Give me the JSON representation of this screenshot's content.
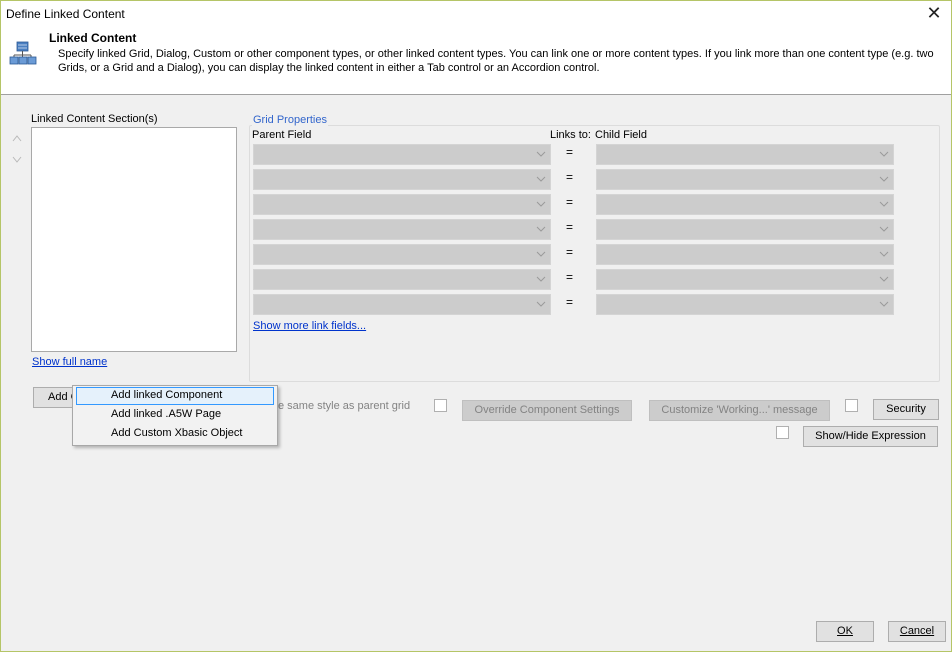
{
  "window": {
    "title": "Define Linked Content",
    "close_glyph": "✕"
  },
  "header": {
    "title": "Linked Content",
    "description": "Specify linked Grid, Dialog, Custom or other component types, or other linked content types. You can link one or more content types. If you link more than one content type (e.g. two Grids, or a Grid and a Dialog), you can display the linked content in either a Tab control or an Accordion control.",
    "icon": "linked-content-icon"
  },
  "left_panel": {
    "section_label": "Linked Content Section(s)",
    "items": [],
    "show_full_name_link": "Show full name",
    "move_up_icon": "triangle-up-icon",
    "move_down_icon": "triangle-down-icon"
  },
  "grid_properties": {
    "legend": "Grid Properties",
    "parent_field_header": "Parent Field",
    "links_to_header": "Links to:",
    "child_field_header": "Child Field",
    "rows": [
      {
        "parent": "",
        "operator": "=",
        "child": ""
      },
      {
        "parent": "",
        "operator": "=",
        "child": ""
      },
      {
        "parent": "",
        "operator": "=",
        "child": ""
      },
      {
        "parent": "",
        "operator": "=",
        "child": ""
      },
      {
        "parent": "",
        "operator": "=",
        "child": ""
      },
      {
        "parent": "",
        "operator": "=",
        "child": ""
      },
      {
        "parent": "",
        "operator": "=",
        "child": ""
      }
    ],
    "show_more_link": "Show more link fields..."
  },
  "actions": {
    "add_button_label": "Add C",
    "same_style_label": "e same style as parent grid",
    "override_button": "Override Component Settings",
    "customize_button": "Customize 'Working...' message",
    "security_button": "Security",
    "show_hide_button": "Show/Hide Expression"
  },
  "context_menu": {
    "items": [
      {
        "label": "Add linked Component",
        "highlighted": true
      },
      {
        "label": "Add linked .A5W Page",
        "highlighted": false
      },
      {
        "label": "Add Custom Xbasic Object",
        "highlighted": false
      }
    ]
  },
  "footer": {
    "ok_label": "OK",
    "cancel_label": "Cancel"
  },
  "colors": {
    "accent": "#3366cc",
    "link": "#0033cc",
    "menu_highlight": "#e5f1fb",
    "menu_highlight_border": "#3399ff"
  }
}
